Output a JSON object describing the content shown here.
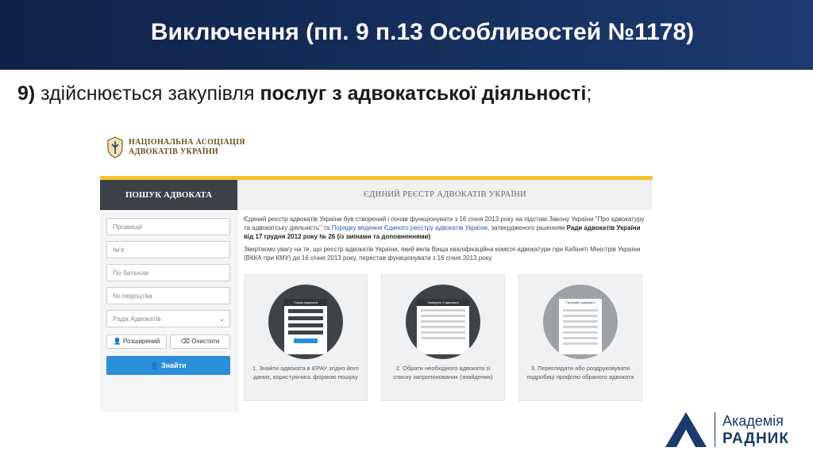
{
  "slide": {
    "title": "Виключення (пп. 9 п.13 Особливостей №1178)",
    "subtitle_num": "9)",
    "subtitle_pre": " здійснюється закупівля ",
    "subtitle_bold": "послуг з адвокатської діяльності",
    "subtitle_end": ";"
  },
  "site": {
    "logo_line1": "НАЦІОНАЛЬНА АСОЦІАЦІЯ",
    "logo_line2": "АДВОКАТІВ УКРАЇНИ",
    "tab_search": "ПОШУК АДВОКАТА",
    "tab_registry": "ЄДИНИЙ РЕЄСТР АДВОКАТІВ УКРАЇНИ",
    "form": {
      "surname_placeholder": "Прізвище",
      "name_placeholder": "Ім'я",
      "patronymic_placeholder": "По батькові",
      "certificate_placeholder": "№ свідоцтва",
      "council_select": "Рада Адвокатів",
      "extended_button": "Розширений",
      "clear_button": "Очистити",
      "search_button": "Знайти"
    },
    "intro": {
      "p1_text": "Єдиний реєстр адвокатів України був створений і почав функціонувати з 16 січня 2013 року на підставі Закону України \"Про адвокатуру та адвокатську діяльність\" та ",
      "p1_link": "Порядку ведення Єдиного реєстру адвокатів України",
      "p1_tail": ", затвердженого рішенням ",
      "p1_bold": "Ради адвокатів України від 17 грудня 2012 року № 26 (із змінами та доповненнями)",
      "p2_text": "Звертаємо увагу на те, що реєстр адвокатів України, який вела Вища кваліфікаційна комісія адвокатури при Кабінеті Міністрів України (ВККА при КМУ) до 16 січня 2013 року, перестав функціонувати з 16 січня 2013 року."
    },
    "cards": [
      {
        "mock_title": "Пошук Адвоката",
        "text": "1. Знайти адвоката в ЄРАУ згідно його даних, користуючись формою пошуку"
      },
      {
        "mock_title": "Знайдено 2 адвоката",
        "text": "2. Обрати необхідного адвоката зі списку запропонованих (знайдених)"
      },
      {
        "mock_title": "Профайл Адвоката",
        "text": "3. Переглядати або роздруковувати подробиці профілю обраного адвоката"
      }
    ]
  },
  "brand": {
    "line1": "Академія",
    "line2": "РАДНИК"
  },
  "colors": {
    "title_bar": "#16305f",
    "accent_gold": "#f2c32e",
    "search_button": "#2d8fd8",
    "brand": "#1b3a6b"
  }
}
